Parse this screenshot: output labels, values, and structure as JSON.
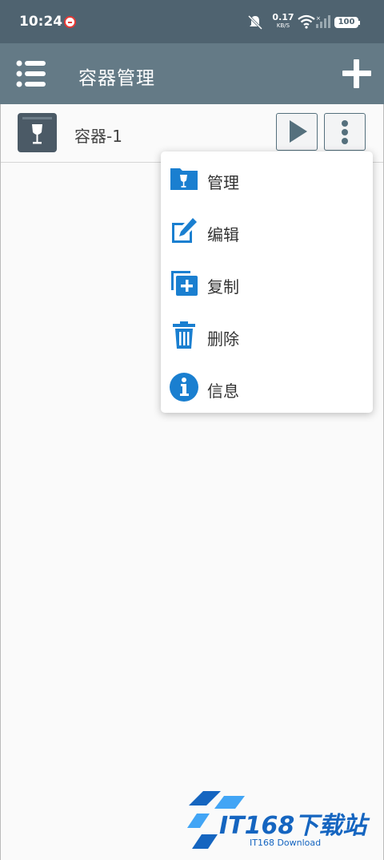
{
  "status_bar": {
    "time": "10:24",
    "net_speed_value": "0.17",
    "net_speed_unit": "KB/S",
    "battery": "100"
  },
  "app_bar": {
    "title": "容器管理"
  },
  "containers": [
    {
      "label": "容器-1"
    }
  ],
  "popup_menu": {
    "items": [
      {
        "label": "管理",
        "icon": "folder-wine-icon"
      },
      {
        "label": "编辑",
        "icon": "edit-icon"
      },
      {
        "label": "复制",
        "icon": "copy-icon"
      },
      {
        "label": "删除",
        "icon": "trash-icon"
      },
      {
        "label": "信息",
        "icon": "info-icon"
      }
    ]
  },
  "watermark": {
    "text": "IT168下载站",
    "sub": "IT168 Download"
  },
  "colors": {
    "status_bar": "#4f6370",
    "app_bar": "#647a86",
    "accent": "#1a7fd0"
  }
}
